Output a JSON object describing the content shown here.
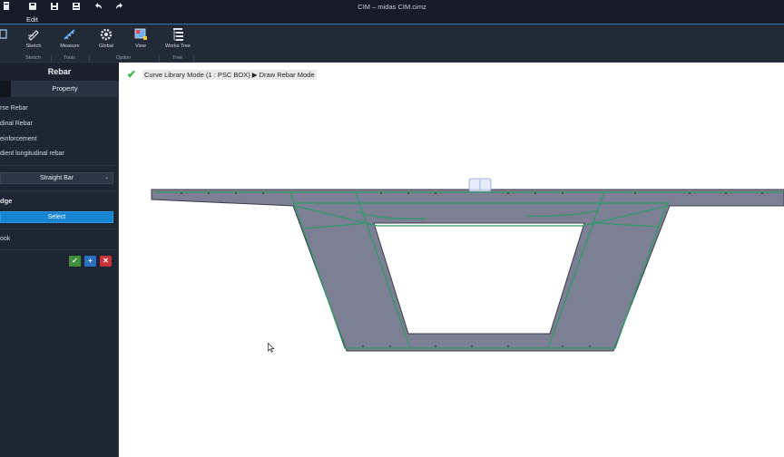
{
  "window": {
    "title": "CIM – midas CIM.cimz"
  },
  "quick_access": [
    {
      "name": "new-icon",
      "glyph": "■"
    },
    {
      "name": "open-folder-icon",
      "glyph": "■"
    },
    {
      "name": "save-icon",
      "glyph": "▣"
    },
    {
      "name": "save-as-icon",
      "glyph": "▤"
    },
    {
      "name": "undo-icon",
      "glyph": "↶"
    },
    {
      "name": "redo-icon",
      "glyph": "↷"
    }
  ],
  "menu": {
    "edit": "Edit"
  },
  "ribbon": {
    "buttons": {
      "sketch": "Sketch",
      "measure": "Measure",
      "global": "Global",
      "view": "View",
      "works_tree": "Works Tree"
    },
    "groups": {
      "sketch": "Sketch",
      "tools": "Tools",
      "option": "Option",
      "tree": "Tree"
    }
  },
  "panel": {
    "title": "Rebar",
    "tab_property": "Property",
    "options": [
      "rse Rebar",
      "dinal Rebar",
      "einforcement",
      "dient longitudinal rebar"
    ],
    "dropdown_value": "Straight Bar",
    "edge_label": "dge",
    "select_label": "Select",
    "hook_label": "ook",
    "confirm_icon": "✓",
    "add_icon": "+",
    "cancel_icon": "✕"
  },
  "status": {
    "mode_text": "Curve Library Mode (1 : PSC BOX) ▶ Draw Rebar Mode"
  },
  "colors": {
    "section_fill": "#7d7f95",
    "rebar_green": "#2f9a68",
    "accent_blue": "#1784d1",
    "confirm_green": "#3f8f3a",
    "cancel_red": "#c8323a"
  }
}
